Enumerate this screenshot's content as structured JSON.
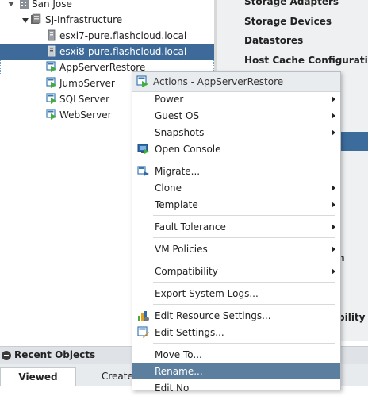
{
  "tree": {
    "items": [
      {
        "label": "San Jose"
      },
      {
        "label": "SJ-Infrastructure"
      },
      {
        "label": "esxi7-pure.flashcloud.local"
      },
      {
        "label": "esxi8-pure.flashcloud.local"
      },
      {
        "label": "AppServerRestore"
      },
      {
        "label": "JumpServer"
      },
      {
        "label": "SQLServer"
      },
      {
        "label": "WebServer"
      }
    ]
  },
  "right_panel": {
    "items": [
      "Storage Adapters",
      "Storage Devices",
      "Datastores",
      "Host Cache Configuration"
    ],
    "fragments": [
      "n",
      "bility"
    ]
  },
  "recent": {
    "title": "Recent Objects",
    "tabs": [
      "Viewed",
      "Create"
    ]
  },
  "context_menu": {
    "header": "Actions - AppServerRestore",
    "items": [
      {
        "label": "Power"
      },
      {
        "label": "Guest OS"
      },
      {
        "label": "Snapshots"
      },
      {
        "label": "Open Console"
      },
      {
        "label": "Migrate..."
      },
      {
        "label": "Clone"
      },
      {
        "label": "Template"
      },
      {
        "label": "Fault Tolerance"
      },
      {
        "label": "VM Policies"
      },
      {
        "label": "Compatibility"
      },
      {
        "label": "Export System Logs..."
      },
      {
        "label": "Edit Resource Settings..."
      },
      {
        "label": "Edit Settings..."
      },
      {
        "label": "Move To..."
      },
      {
        "label": "Rename..."
      },
      {
        "label": "Edit No"
      }
    ]
  },
  "colors": {
    "selection": "#3e6a9a",
    "menu_highlight": "#5d7f9f",
    "vm_green": "#4caf50"
  }
}
